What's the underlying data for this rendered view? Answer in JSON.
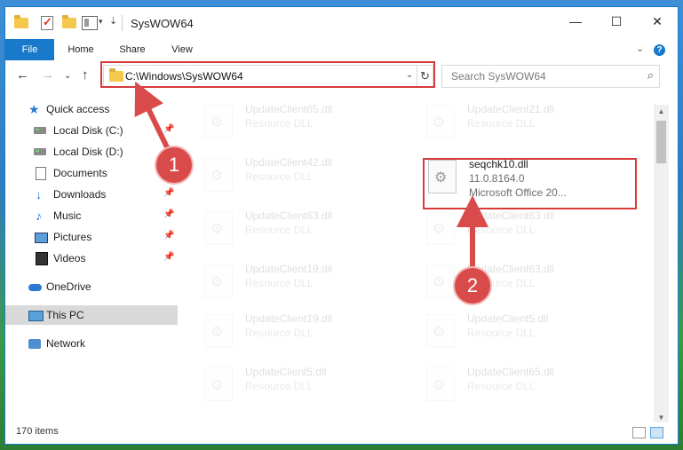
{
  "window": {
    "title": "SysWOW64",
    "controls": {
      "minimize": "—",
      "maximize": "☐",
      "close": "✕"
    }
  },
  "ribbon": {
    "tabs": [
      "File",
      "Home",
      "Share",
      "View"
    ],
    "expand": "⌄",
    "help": "?"
  },
  "nav": {
    "back": "←",
    "forward": "→",
    "recent": "⌄",
    "up": "↑",
    "address": "C:\\Windows\\SysWOW64",
    "address_dropdown": "⌄",
    "refresh": "↻",
    "search_placeholder": "Search SysWOW64",
    "search_icon": "⌕"
  },
  "sidebar": {
    "items": [
      {
        "label": "Quick access",
        "icon": "star-icon",
        "pinned": false
      },
      {
        "label": "Local Disk (C:)",
        "icon": "disk-icon",
        "pinned": true
      },
      {
        "label": "Local Disk (D:)",
        "icon": "disk-icon",
        "pinned": false
      },
      {
        "label": "Documents",
        "icon": "document-icon",
        "pinned": true
      },
      {
        "label": "Downloads",
        "icon": "download-icon",
        "pinned": true
      },
      {
        "label": "Music",
        "icon": "music-icon",
        "pinned": true
      },
      {
        "label": "Pictures",
        "icon": "pictures-icon",
        "pinned": true
      },
      {
        "label": "Videos",
        "icon": "videos-icon",
        "pinned": true
      },
      {
        "label": "OneDrive",
        "icon": "cloud-icon",
        "pinned": false
      },
      {
        "label": "This PC",
        "icon": "computer-icon",
        "pinned": false,
        "selected": true
      },
      {
        "label": "Network",
        "icon": "network-icon",
        "pinned": false
      }
    ],
    "pin_glyph": "📌"
  },
  "files": {
    "left": [
      {
        "name": "UpdateClient65.dll",
        "type": "Resource DLL"
      },
      {
        "name": "UpdateClient42.dll",
        "type": "Resource DLL"
      },
      {
        "name": "UpdateClient63.dll",
        "type": "Resource DLL"
      },
      {
        "name": "UpdateClient19.dll",
        "type": "Resource DLL"
      },
      {
        "name": "UpdateClient19.dll",
        "type": "Resource DLL"
      },
      {
        "name": "UpdateClient5.dll",
        "type": "Resource DLL"
      }
    ],
    "right": [
      {
        "name": "UpdateClient21.dll",
        "type": "Resource DLL"
      },
      {
        "name": "seqchk10.dll",
        "type": "11.0.8164.0",
        "description": "Microsoft Office 20...",
        "highlighted": true
      },
      {
        "name": "UpdateClient63.dll",
        "type": "Resource DLL"
      },
      {
        "name": "UpdateClient63.dll",
        "type": "Resource DLL"
      },
      {
        "name": "UpdateClient5.dll",
        "type": "Resource DLL"
      },
      {
        "name": "UpdateClient65.dll",
        "type": "Resource DLL"
      }
    ]
  },
  "status": {
    "item_count": "170 items"
  },
  "annotations": {
    "step1": "1",
    "step2": "2",
    "color": "#d94a4a"
  }
}
